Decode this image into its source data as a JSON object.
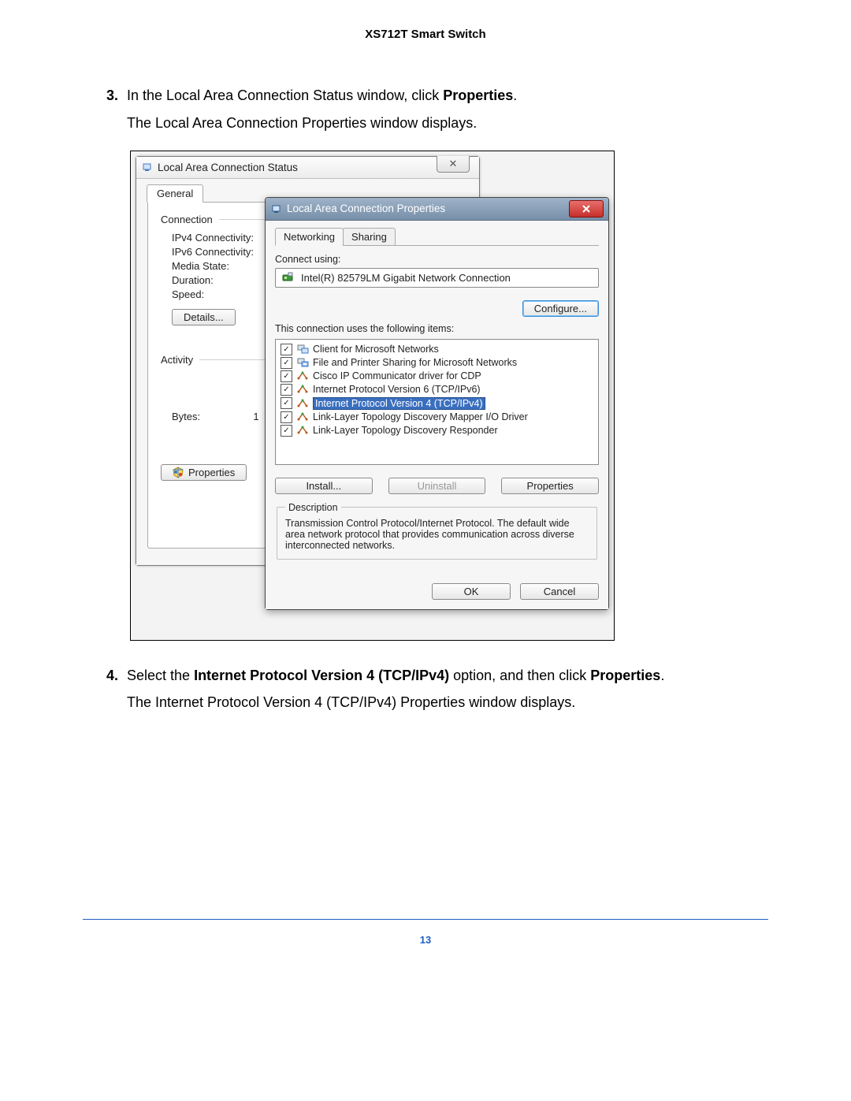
{
  "header": {
    "title": "XS712T Smart Switch"
  },
  "steps": {
    "s3": {
      "num": "3.",
      "text_before": "In the Local Area Connection Status window, click ",
      "text_bold": "Properties",
      "text_after": ".",
      "sub": "The Local Area Connection Properties window displays."
    },
    "s4": {
      "num": "4.",
      "text_before": "Select the ",
      "text_bold1": "Internet Protocol Version 4 (TCP/IPv4)",
      "text_mid": " option, and then click ",
      "text_bold2": "Properties",
      "text_after": ".",
      "sub": "The Internet Protocol Version 4 (TCP/IPv4) Properties window displays."
    }
  },
  "status_window": {
    "title": "Local Area Connection Status",
    "tab": "General",
    "connection_label": "Connection",
    "ipv4": "IPv4 Connectivity:",
    "ipv6": "IPv6 Connectivity:",
    "media": "Media State:",
    "duration": "Duration:",
    "speed": "Speed:",
    "details_btn": "Details...",
    "activity_label": "Activity",
    "bytes": "Bytes:",
    "bytes_val": "1",
    "properties_btn": "Properties"
  },
  "props_window": {
    "title": "Local Area Connection Properties",
    "tabs": {
      "networking": "Networking",
      "sharing": "Sharing"
    },
    "connect_using": "Connect using:",
    "adapter": "Intel(R) 82579LM Gigabit Network Connection",
    "configure_btn": "Configure...",
    "items_label": "This connection uses the following items:",
    "items": [
      "Client for Microsoft Networks",
      "File and Printer Sharing for Microsoft Networks",
      "Cisco IP Communicator driver for CDP",
      "Internet Protocol Version 6 (TCP/IPv6)",
      "Internet Protocol Version 4 (TCP/IPv4)",
      "Link-Layer Topology Discovery Mapper I/O Driver",
      "Link-Layer Topology Discovery Responder"
    ],
    "install_btn": "Install...",
    "uninstall_btn": "Uninstall",
    "properties_btn": "Properties",
    "description_label": "Description",
    "description": "Transmission Control Protocol/Internet Protocol. The default wide area network protocol that provides communication across diverse interconnected networks.",
    "ok": "OK",
    "cancel": "Cancel"
  },
  "page_number": "13"
}
